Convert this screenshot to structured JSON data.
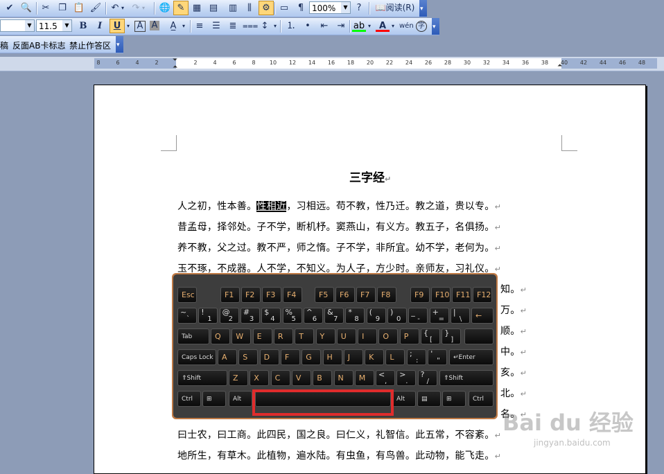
{
  "toolbar1": {
    "items": [
      "spelling-icon",
      "research-icon",
      "cut-icon",
      "copy-icon",
      "paste-icon",
      "format-painter-icon",
      "undo-icon",
      "redo-icon",
      "hyperlink-icon",
      "tables-borders-icon",
      "insert-table-icon",
      "insert-excel-icon",
      "columns-icon",
      "drawing-icon",
      "document-map-icon",
      "show-hide-icon",
      "zoom-dropdown-icon",
      "help-icon"
    ],
    "zoom": "100%",
    "read_label": "阅读(R)"
  },
  "toolbar2": {
    "font_size": "11.5",
    "bold": "B",
    "italic": "I",
    "underline": "U",
    "char_border": "A",
    "char_shading": "A",
    "font_color": "A",
    "phonetic": "wén",
    "enclosed": "字"
  },
  "toolbar3": {
    "items": [
      "稿",
      "反面AB卡标志",
      "禁止作答区"
    ]
  },
  "ruler": {
    "numbers": [
      "8",
      "6",
      "4",
      "2",
      "2",
      "4",
      "6",
      "8",
      "10",
      "12",
      "14",
      "16",
      "18",
      "20",
      "22",
      "24",
      "26",
      "28",
      "30",
      "32",
      "34",
      "36",
      "38",
      "40",
      "42",
      "44",
      "46",
      "48"
    ]
  },
  "document": {
    "title": "三字经",
    "lines": [
      {
        "before": "人之初，性本善。",
        "highlight": "性相近",
        "after": "，习相远。苟不教，性乃迁。教之道，贵以专。"
      },
      {
        "text": "昔孟母，择邻处。子不学，断机杼。窦燕山，有义方。教五子，名俱扬。"
      },
      {
        "text": "养不教，父之过。教不严，师之惰。子不学，非所宜。幼不学，老何为。"
      },
      {
        "text": "玉不琢，不成器。人不学，不知义。为人子，方少时。亲师友，习礼仪。"
      },
      {
        "text": "知。"
      },
      {
        "text": "万。"
      },
      {
        "text": "顺。"
      },
      {
        "text": "中。"
      },
      {
        "text": "亥。"
      },
      {
        "text": "北。"
      },
      {
        "text": "名。"
      },
      {
        "text": "曰士农，曰工商。此四民，国之良。曰仁义，礼智信。此五常，不容紊。"
      },
      {
        "text": "地所生，有草木。此植物，遍水陆。有虫鱼，有鸟兽。此动物，能飞走。"
      }
    ],
    "paragraph_mark": "↵"
  },
  "keyboard": {
    "row_f": [
      "Esc",
      "F1",
      "F2",
      "F3",
      "F4",
      "F5",
      "F6",
      "F7",
      "F8",
      "F9",
      "F10",
      "F11",
      "F12"
    ],
    "row_num": [
      [
        "~",
        "`"
      ],
      [
        "!",
        "1"
      ],
      [
        "@",
        "2"
      ],
      [
        "#",
        "3"
      ],
      [
        "$",
        "4"
      ],
      [
        "%",
        "5"
      ],
      [
        "^",
        "6"
      ],
      [
        "&",
        "7"
      ],
      [
        "*",
        "8"
      ],
      [
        "(",
        "9"
      ],
      [
        ")",
        "0"
      ],
      [
        "_",
        "-"
      ],
      [
        "+",
        "="
      ],
      [
        "|",
        "\\"
      ]
    ],
    "backspace": "←",
    "tab": "Tab",
    "row_q": [
      "Q",
      "W",
      "E",
      "R",
      "T",
      "Y",
      "U",
      "I",
      "O",
      "P"
    ],
    "row_q_extra": [
      [
        "{",
        "["
      ],
      [
        "}",
        "]"
      ]
    ],
    "caps": "Caps Lock",
    "row_a": [
      "A",
      "S",
      "D",
      "F",
      "G",
      "H",
      "J",
      "K",
      "L"
    ],
    "row_a_extra": [
      [
        ";",
        ":"
      ],
      [
        "'",
        "\""
      ]
    ],
    "enter": "↵Enter",
    "shift_left": "⇑Shift",
    "row_z": [
      "Z",
      "X",
      "C",
      "V",
      "B",
      "N",
      "M"
    ],
    "row_z_extra": [
      [
        "<",
        ","
      ],
      [
        ">",
        "."
      ],
      [
        "?",
        "/"
      ]
    ],
    "shift_right": "⇑Shift",
    "ctrl": "Ctrl",
    "alt": "Alt",
    "space": ""
  },
  "watermark": {
    "brand": "Bai du 经验",
    "url": "jingyan.baidu.com"
  }
}
